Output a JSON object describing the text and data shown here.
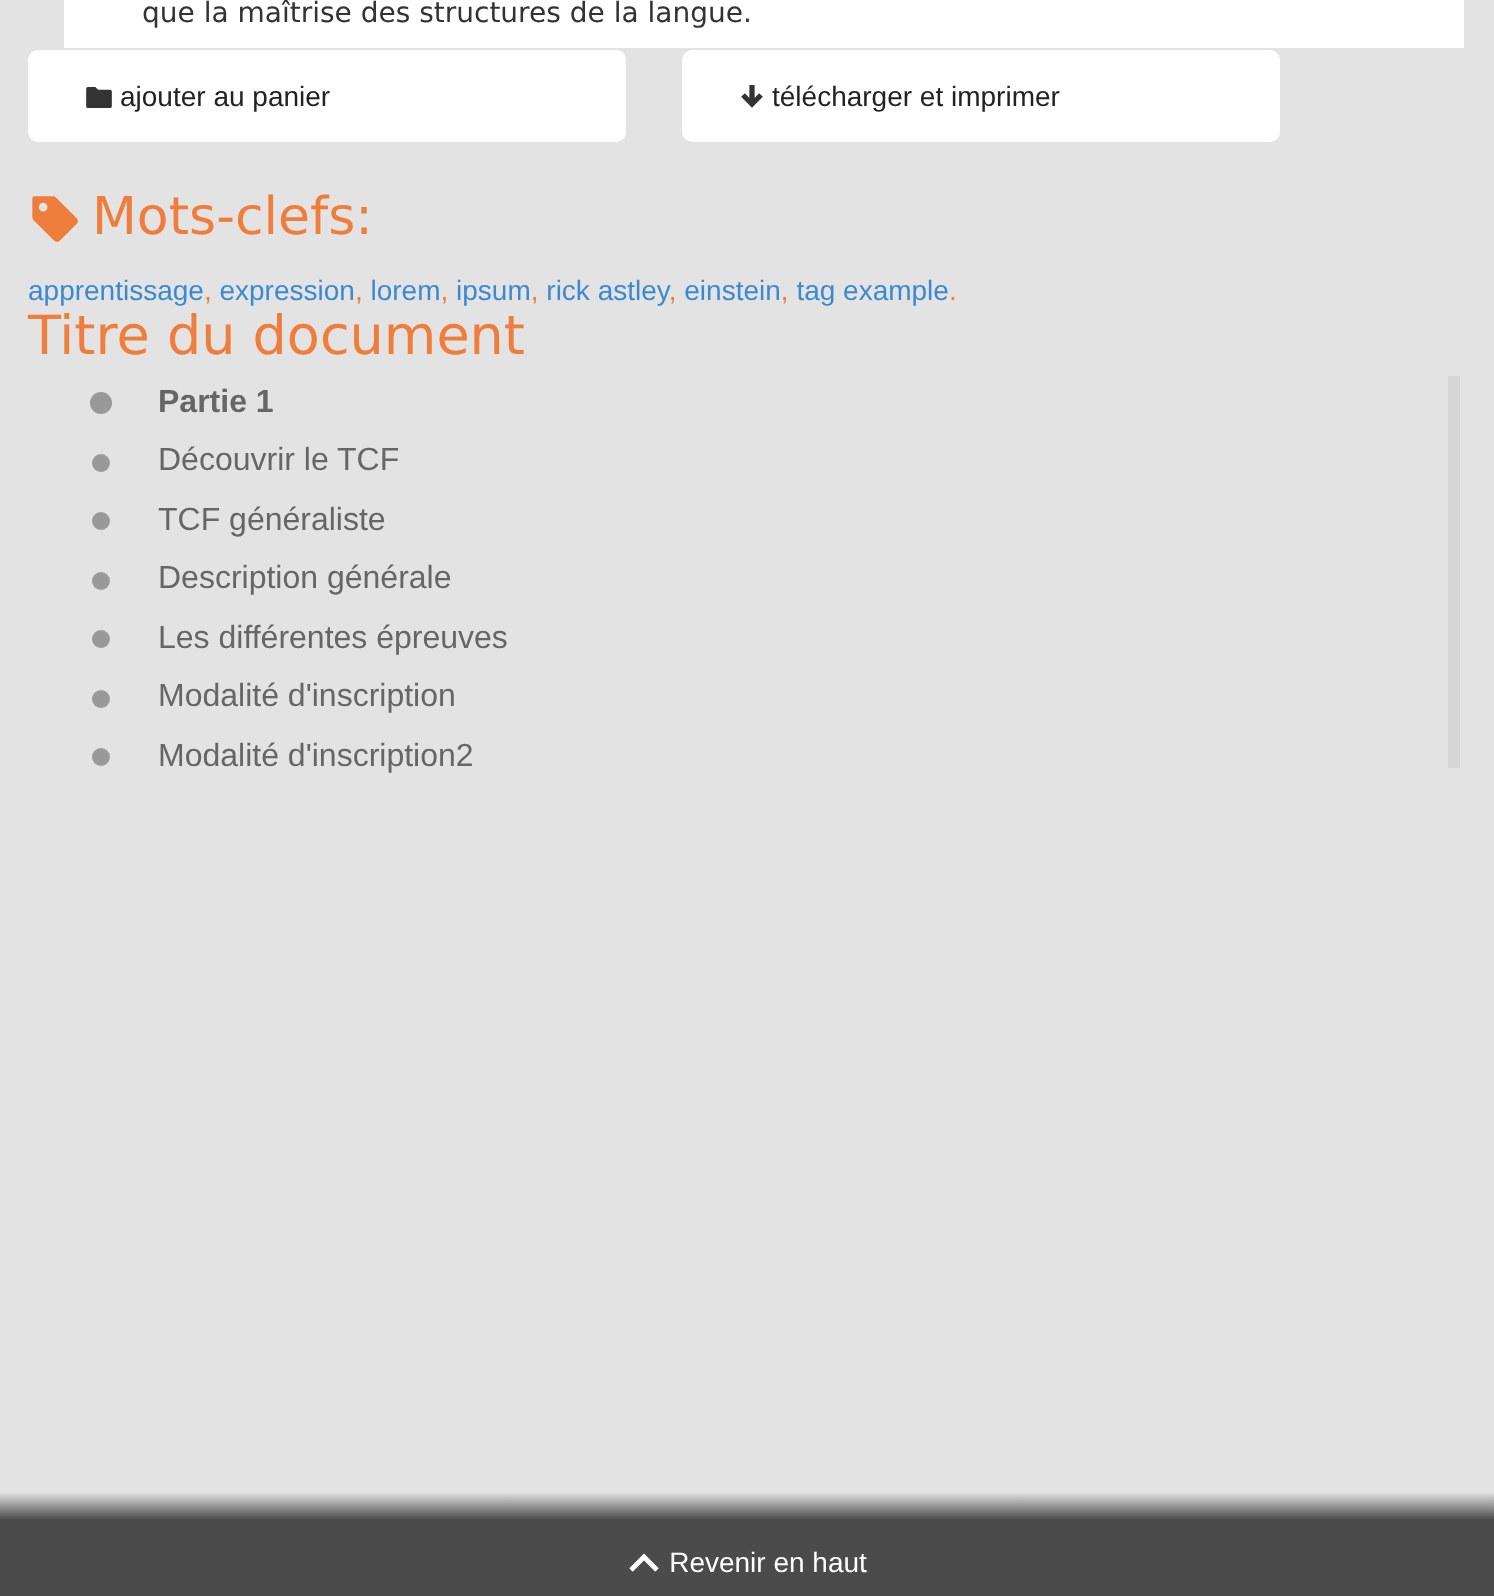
{
  "excerpt": {
    "text": "que la maîtrise des structures de la langue."
  },
  "actions": [
    {
      "kind": "folder",
      "label": "ajouter au panier"
    },
    {
      "kind": "download",
      "label": "télécharger et imprimer"
    }
  ],
  "keywords": {
    "title": "Mots-clefs:",
    "tags": [
      {
        "label": "apprentissage",
        "punct": ","
      },
      {
        "label": "expression",
        "punct": ","
      },
      {
        "label": "lorem",
        "punct": ","
      },
      {
        "label": "ipsum",
        "punct": ","
      },
      {
        "label": "rick astley",
        "punct": ","
      },
      {
        "label": "einstein",
        "punct": ","
      },
      {
        "label": "tag example",
        "punct": "."
      }
    ]
  },
  "document": {
    "title": "Titre du document",
    "items": [
      {
        "kind": "section",
        "label": "Partie 1"
      },
      {
        "kind": "link",
        "label": "Découvrir le TCF"
      },
      {
        "kind": "link",
        "label": "TCF généraliste"
      },
      {
        "kind": "link",
        "label": "Description générale"
      },
      {
        "kind": "link",
        "label": "Les différentes épreuves"
      },
      {
        "kind": "link",
        "label": "Modalité d'inscription"
      },
      {
        "kind": "link",
        "label": "Modalité d'inscription2"
      }
    ]
  },
  "footer": {
    "label": "Revenir en haut"
  }
}
